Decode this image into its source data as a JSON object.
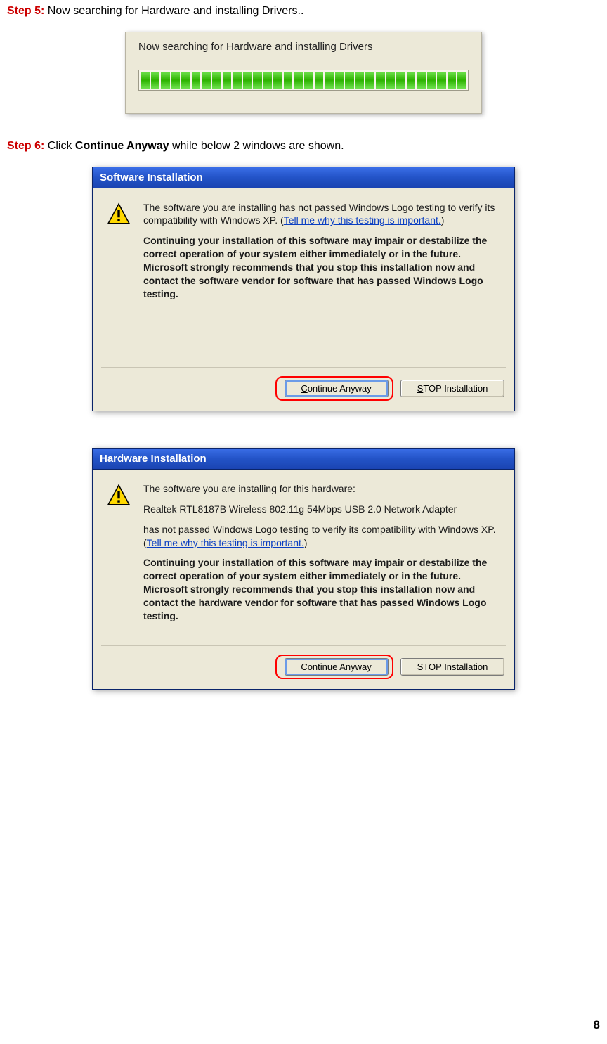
{
  "page_number": "8",
  "step5": {
    "label": "Step 5:",
    "text": " Now searching for Hardware and installing Drivers.."
  },
  "progress_dialog": {
    "title": "Now searching for Hardware and installing Drivers"
  },
  "step6": {
    "label": "Step 6:",
    "pre": " Click ",
    "bold": "Continue Anyway",
    "post": " while below 2 windows are shown."
  },
  "software_dialog": {
    "title": "Software Installation",
    "p1a": "The software you are installing has not passed Windows Logo testing to verify its compatibility with Windows XP. (",
    "link": "Tell me why this testing is important.",
    "p1b": ")",
    "bold": "Continuing your installation of this software may impair or destabilize the correct operation of your system either immediately or in the future. Microsoft strongly recommends that you stop this installation now and contact the software vendor for software that has passed Windows Logo testing.",
    "continue_prefix": "C",
    "continue_rest": "ontinue Anyway",
    "stop_prefix": "S",
    "stop_rest": "TOP Installation"
  },
  "hardware_dialog": {
    "title": "Hardware Installation",
    "p1": "The software you are installing for this hardware:",
    "p2": "Realtek RTL8187B Wireless 802.11g 54Mbps USB 2.0 Network Adapter",
    "p3a": "has not passed Windows Logo testing to verify its compatibility with Windows XP. (",
    "link": "Tell me why this testing is important.",
    "p3b": ")",
    "bold": "Continuing your installation of this software may impair or destabilize the correct operation of your system either immediately or in the future. Microsoft strongly recommends that you stop this installation now and contact the hardware vendor for software that has passed Windows Logo testing.",
    "continue_prefix": "C",
    "continue_rest": "ontinue Anyway",
    "stop_prefix": "S",
    "stop_rest": "TOP Installation"
  }
}
